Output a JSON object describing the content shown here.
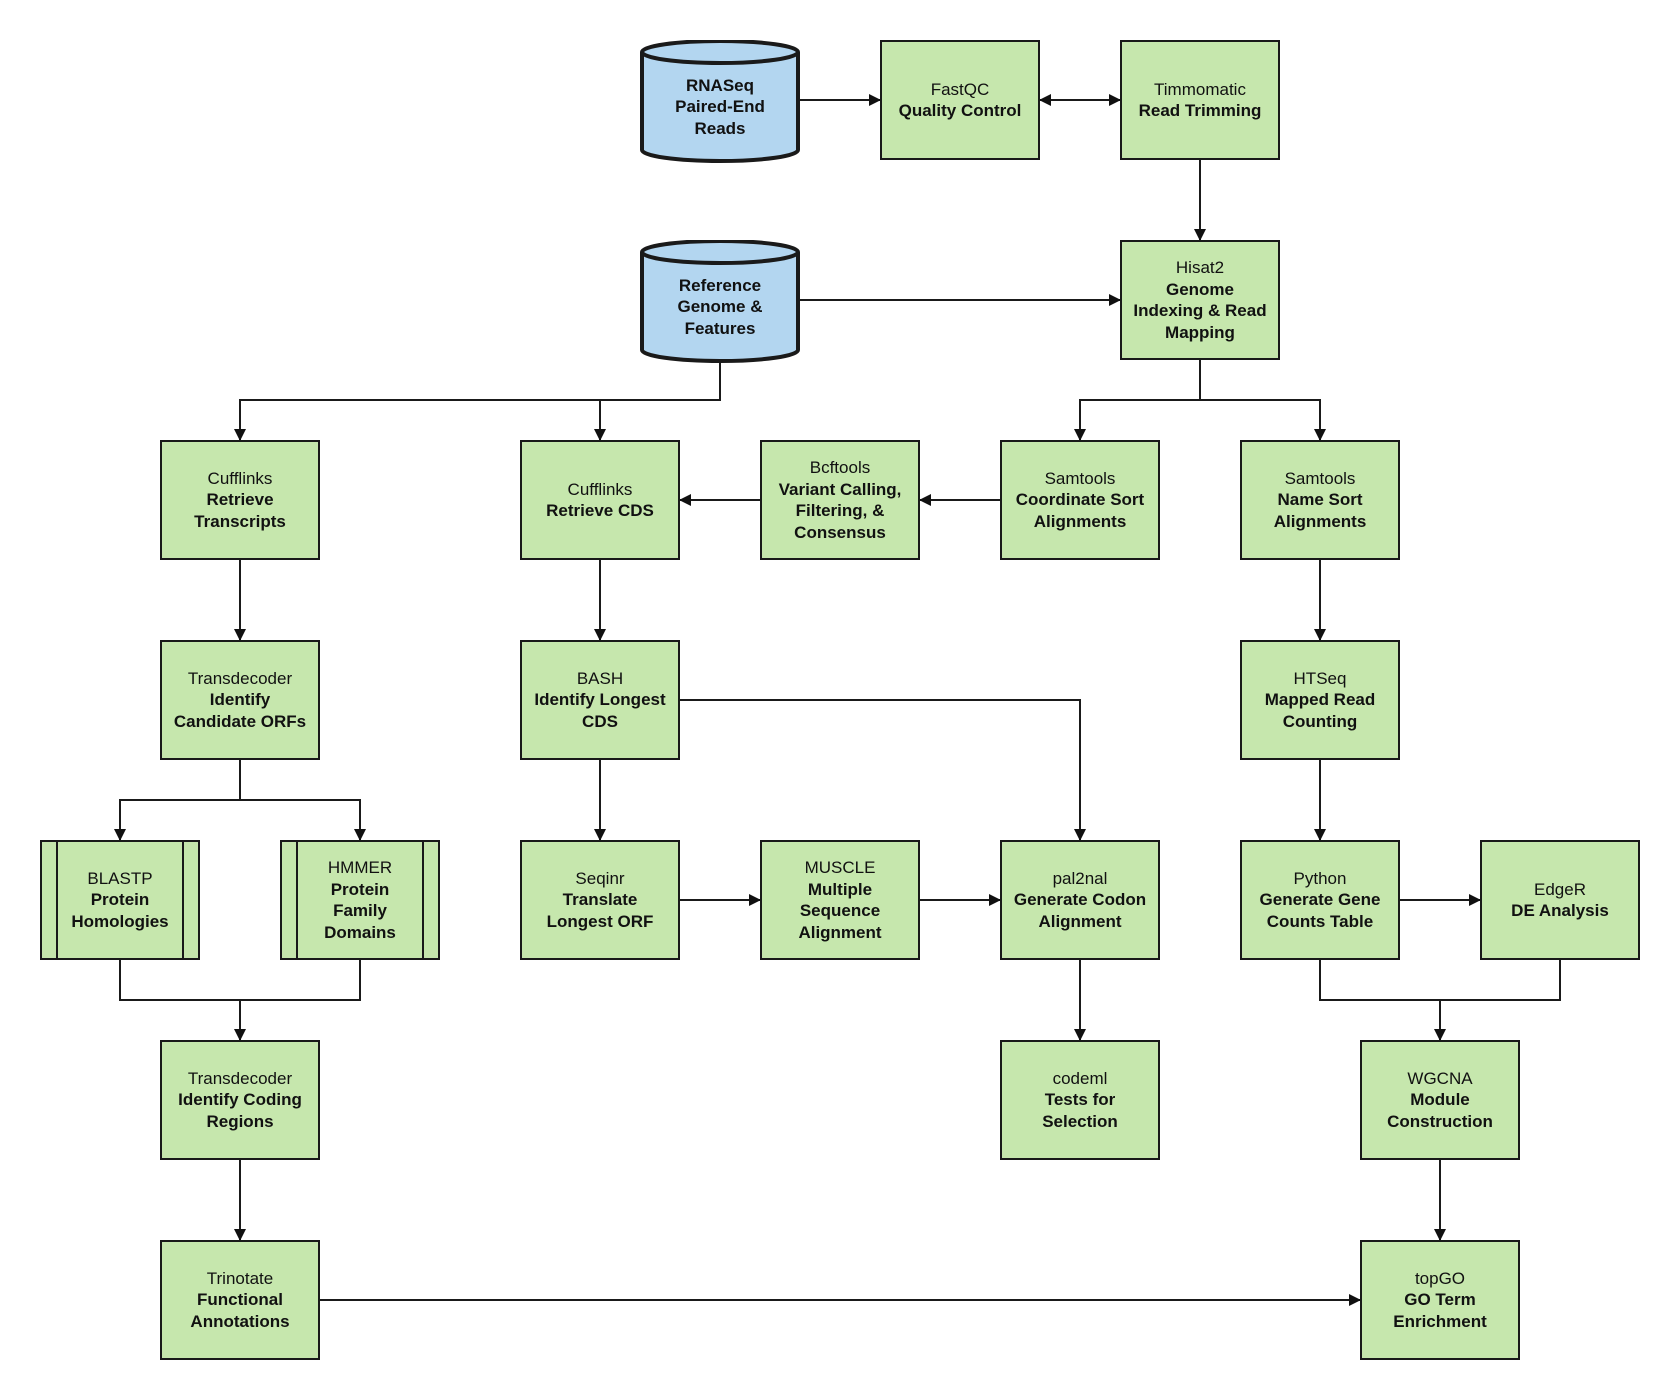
{
  "colors": {
    "process_fill": "#c6e7ad",
    "database_fill": "#b3d6f0",
    "stroke": "#1a1a1a"
  },
  "nodes": {
    "rnaseq": {
      "type": "database",
      "label": [
        "RNASeq",
        "Paired-End",
        "Reads"
      ]
    },
    "fastqc": {
      "type": "process",
      "tool": "FastQC",
      "task": [
        "Quality Control"
      ]
    },
    "trimmomatic": {
      "type": "process",
      "tool": "Timmomatic",
      "task": [
        "Read Trimming"
      ]
    },
    "reference": {
      "type": "database",
      "label": [
        "Reference",
        "Genome &",
        "Features"
      ]
    },
    "hisat2": {
      "type": "process",
      "tool": "Hisat2",
      "task": [
        "Genome",
        "Indexing & Read",
        "Mapping"
      ]
    },
    "cufflinks_transcripts": {
      "type": "process",
      "tool": "Cufflinks",
      "task": [
        "Retrieve",
        "Transcripts"
      ]
    },
    "cufflinks_cds": {
      "type": "process",
      "tool": "Cufflinks",
      "task": [
        "Retrieve CDS"
      ]
    },
    "bcftools": {
      "type": "process",
      "tool": "Bcftools",
      "task": [
        "Variant Calling,",
        "Filtering, &",
        "Consensus"
      ]
    },
    "samtools_coord": {
      "type": "process",
      "tool": "Samtools",
      "task": [
        "Coordinate Sort",
        "Alignments"
      ]
    },
    "samtools_name": {
      "type": "process",
      "tool": "Samtools",
      "task": [
        "Name Sort",
        "Alignments"
      ]
    },
    "transdecoder_orfs": {
      "type": "process",
      "tool": "Transdecoder",
      "task": [
        "Identify",
        "Candidate ORFs"
      ]
    },
    "bash": {
      "type": "process",
      "tool": "BASH",
      "task": [
        "Identify Longest",
        "CDS"
      ]
    },
    "htseq": {
      "type": "process",
      "tool": "HTSeq",
      "task": [
        "Mapped Read",
        "Counting"
      ]
    },
    "blastp": {
      "type": "subroutine",
      "tool": "BLASTP",
      "task": [
        "Protein",
        "Homologies"
      ]
    },
    "hmmer": {
      "type": "subroutine",
      "tool": "HMMER",
      "task": [
        "Protein",
        "Family",
        "Domains"
      ]
    },
    "seqinr": {
      "type": "process",
      "tool": "Seqinr",
      "task": [
        "Translate",
        "Longest ORF"
      ]
    },
    "muscle": {
      "type": "process",
      "tool": "MUSCLE",
      "task": [
        "Multiple",
        "Sequence",
        "Alignment"
      ]
    },
    "pal2nal": {
      "type": "process",
      "tool": "pal2nal",
      "task": [
        "Generate Codon",
        "Alignment"
      ]
    },
    "python": {
      "type": "process",
      "tool": "Python",
      "task": [
        "Generate Gene",
        "Counts Table"
      ]
    },
    "edger": {
      "type": "process",
      "tool": "EdgeR",
      "task": [
        "DE Analysis"
      ]
    },
    "transdecoder_coding": {
      "type": "process",
      "tool": "Transdecoder",
      "task": [
        "Identify Coding",
        "Regions"
      ]
    },
    "codeml": {
      "type": "process",
      "tool": "codeml",
      "task": [
        "Tests for",
        "Selection"
      ]
    },
    "wgcna": {
      "type": "process",
      "tool": "WGCNA",
      "task": [
        "Module",
        "Construction"
      ]
    },
    "trinotate": {
      "type": "process",
      "tool": "Trinotate",
      "task": [
        "Functional",
        "Annotations"
      ]
    },
    "topgo": {
      "type": "process",
      "tool": "topGO",
      "task": [
        "GO Term",
        "Enrichment"
      ]
    }
  },
  "edges": [
    {
      "from": "rnaseq",
      "to": "fastqc"
    },
    {
      "from": "fastqc",
      "to": "trimmomatic",
      "bidirectional": true
    },
    {
      "from": "trimmomatic",
      "to": "hisat2"
    },
    {
      "from": "reference",
      "to": "hisat2"
    },
    {
      "from": "reference",
      "to": "cufflinks_transcripts"
    },
    {
      "from": "reference",
      "to": "cufflinks_cds"
    },
    {
      "from": "hisat2",
      "to": "samtools_coord"
    },
    {
      "from": "hisat2",
      "to": "samtools_name"
    },
    {
      "from": "samtools_coord",
      "to": "bcftools"
    },
    {
      "from": "bcftools",
      "to": "cufflinks_cds"
    },
    {
      "from": "cufflinks_transcripts",
      "to": "transdecoder_orfs"
    },
    {
      "from": "cufflinks_cds",
      "to": "bash"
    },
    {
      "from": "samtools_name",
      "to": "htseq"
    },
    {
      "from": "transdecoder_orfs",
      "to": "blastp"
    },
    {
      "from": "transdecoder_orfs",
      "to": "hmmer"
    },
    {
      "from": "bash",
      "to": "seqinr"
    },
    {
      "from": "bash",
      "to": "pal2nal"
    },
    {
      "from": "seqinr",
      "to": "muscle"
    },
    {
      "from": "muscle",
      "to": "pal2nal"
    },
    {
      "from": "htseq",
      "to": "python"
    },
    {
      "from": "python",
      "to": "edger"
    },
    {
      "from": "blastp",
      "to": "transdecoder_coding"
    },
    {
      "from": "hmmer",
      "to": "transdecoder_coding"
    },
    {
      "from": "pal2nal",
      "to": "codeml"
    },
    {
      "from": "python",
      "to": "wgcna"
    },
    {
      "from": "edger",
      "to": "wgcna"
    },
    {
      "from": "transdecoder_coding",
      "to": "trinotate"
    },
    {
      "from": "wgcna",
      "to": "topgo"
    },
    {
      "from": "trinotate",
      "to": "topgo"
    }
  ]
}
